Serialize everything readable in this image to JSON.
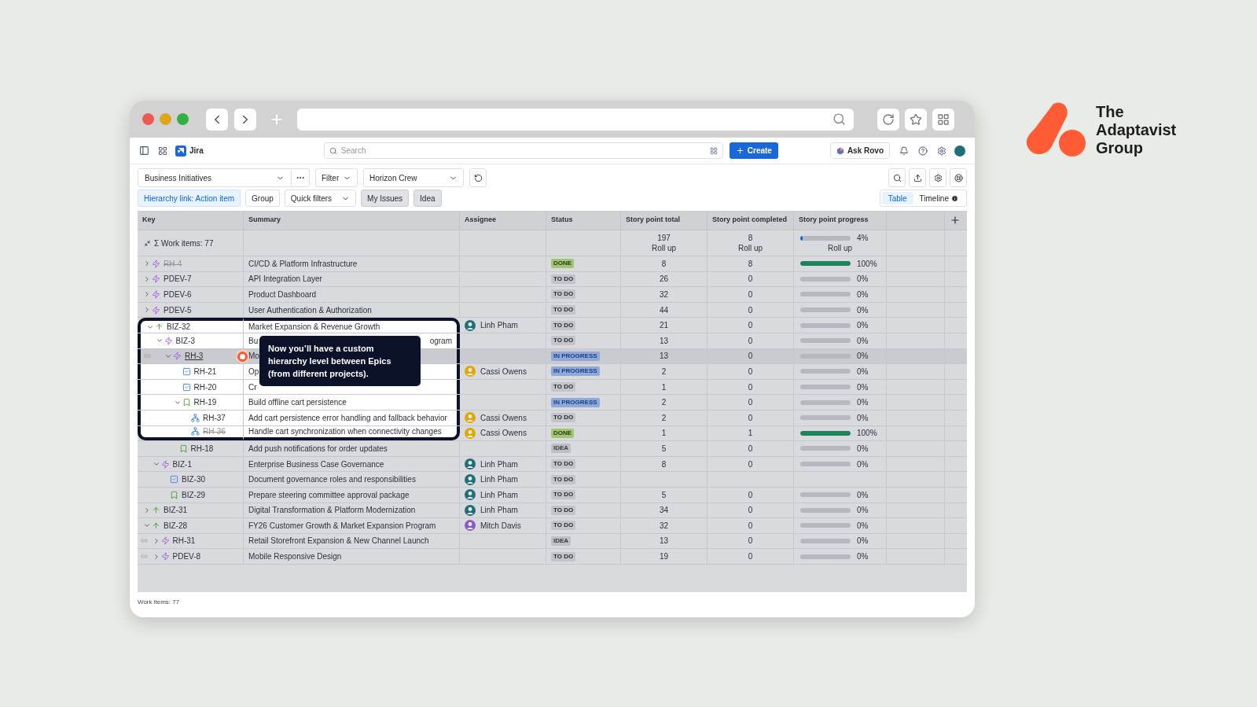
{
  "brand": {
    "name": "The Adaptavist Group"
  },
  "app": {
    "name": "Jira",
    "search_placeholder": "Search",
    "create": "Create",
    "ask": "Ask Rovo"
  },
  "toolbar": {
    "plan": "Business Initiatives",
    "filter": "Filter",
    "team": "Horizon Crew",
    "chips": [
      {
        "label": "Hierarchy link: Action item",
        "kind": "active"
      },
      {
        "label": "Group",
        "kind": "plain"
      },
      {
        "label": "Quick filters",
        "kind": "dropdown"
      },
      {
        "label": "My Issues",
        "kind": "toggle"
      },
      {
        "label": "Idea",
        "kind": "toggle"
      }
    ],
    "views": [
      {
        "label": "Table",
        "selected": true,
        "info": false
      },
      {
        "label": "Timeline",
        "selected": false,
        "info": true
      }
    ]
  },
  "table": {
    "columns": [
      "Key",
      "Summary",
      "Assignee",
      "Status",
      "Story point total",
      "Story point completed",
      "Story point progress"
    ],
    "totals": {
      "label": "Σ Work items: 77",
      "total": "197",
      "total_note": "Roll up",
      "completed": "8",
      "completed_note": "Roll up",
      "progress": {
        "level": 0.04,
        "reading": "4%",
        "note": "Roll up"
      }
    },
    "rows": [
      {
        "key": "RH-4",
        "kind": "epic",
        "summary": "CI/CD & Platform Infrastructure",
        "status": {
          "label": "DONE",
          "kind": "done"
        },
        "total": "8",
        "completed": "8",
        "progress": {
          "level": 1,
          "reading": "100%"
        },
        "expanded": false,
        "done": true,
        "linked": false,
        "selected": false,
        "highlighted": false
      },
      {
        "key": "PDEV-7",
        "kind": "epic",
        "summary": "API Integration Layer",
        "status": {
          "label": "TO DO",
          "kind": "todo"
        },
        "total": "26",
        "completed": "0",
        "progress": {
          "level": 0,
          "reading": "0%"
        },
        "expanded": false,
        "done": false,
        "linked": false,
        "selected": false,
        "highlighted": false
      },
      {
        "key": "PDEV-6",
        "kind": "epic",
        "summary": "Product Dashboard",
        "status": {
          "label": "TO DO",
          "kind": "todo"
        },
        "total": "32",
        "completed": "0",
        "progress": {
          "level": 0,
          "reading": "0%"
        },
        "expanded": false,
        "done": false,
        "linked": false,
        "selected": false,
        "highlighted": false
      },
      {
        "key": "PDEV-5",
        "kind": "epic",
        "summary": "User Authentication & Authorization",
        "status": {
          "label": "TO DO",
          "kind": "todo"
        },
        "total": "44",
        "completed": "0",
        "progress": {
          "level": 0,
          "reading": "0%"
        },
        "expanded": false,
        "done": false,
        "linked": false,
        "selected": false,
        "highlighted": false
      },
      {
        "key": "BIZ-32",
        "kind": "initiative",
        "summary": "Market Expansion & Revenue Growth",
        "assignee": {
          "name": "Linh Pham",
          "color": "#1f6f78"
        },
        "status": {
          "label": "TO DO",
          "kind": "todo"
        },
        "total": "21",
        "completed": "0",
        "progress": {
          "level": 0,
          "reading": "0%"
        },
        "expanded": true,
        "done": false,
        "linked": false,
        "selected": false,
        "highlighted": true,
        "children": [
          {
            "key": "BIZ-3",
            "kind": "epic",
            "summary": "Bu",
            "summary_tail": "ogram",
            "status": {
              "label": "TO DO",
              "kind": "todo"
            },
            "total": "13",
            "completed": "0",
            "progress": {
              "level": 0,
              "reading": "0%"
            },
            "expanded": true,
            "done": false,
            "linked": false,
            "selected": false,
            "highlighted": true,
            "children": [
              {
                "key": "RH-3",
                "kind": "epic",
                "summary": "Mo",
                "status": {
                  "label": "IN PROGRESS",
                  "kind": "progress"
                },
                "total": "13",
                "completed": "0",
                "progress": {
                  "level": 0,
                  "reading": "0%"
                },
                "expanded": true,
                "done": false,
                "linked": true,
                "selected": true,
                "highlighted": true,
                "children": [
                  {
                    "key": "RH-21",
                    "kind": "task",
                    "summary": "Op",
                    "assignee": {
                      "name": "Cassi Owens",
                      "color": "#e0a800"
                    },
                    "status": {
                      "label": "IN PROGRESS",
                      "kind": "progress"
                    },
                    "total": "2",
                    "completed": "0",
                    "progress": {
                      "level": 0,
                      "reading": "0%"
                    },
                    "done": false,
                    "linked": false,
                    "selected": false,
                    "highlighted": true
                  },
                  {
                    "key": "RH-20",
                    "kind": "task",
                    "summary": "Cr",
                    "status": {
                      "label": "TO DO",
                      "kind": "todo"
                    },
                    "total": "1",
                    "completed": "0",
                    "progress": {
                      "level": 0,
                      "reading": "0%"
                    },
                    "done": false,
                    "linked": false,
                    "selected": false,
                    "highlighted": true
                  },
                  {
                    "key": "RH-19",
                    "kind": "story",
                    "summary": "Build offline cart persistence",
                    "status": {
                      "label": "IN PROGRESS",
                      "kind": "progress"
                    },
                    "total": "2",
                    "completed": "0",
                    "progress": {
                      "level": 0,
                      "reading": "0%"
                    },
                    "expanded": true,
                    "done": false,
                    "linked": false,
                    "selected": false,
                    "highlighted": true,
                    "children": [
                      {
                        "key": "RH-37",
                        "kind": "subtask",
                        "summary": "Add cart persistence error handling and fallback behavior",
                        "assignee": {
                          "name": "Cassi Owens",
                          "color": "#e0a800"
                        },
                        "status": {
                          "label": "TO DO",
                          "kind": "todo"
                        },
                        "total": "2",
                        "completed": "0",
                        "progress": {
                          "level": 0,
                          "reading": "0%"
                        },
                        "done": false,
                        "linked": false,
                        "selected": false,
                        "highlighted": true
                      },
                      {
                        "key": "RH-36",
                        "kind": "subtask",
                        "summary": "Handle cart synchronization when connectivity changes",
                        "assignee": {
                          "name": "Cassi Owens",
                          "color": "#e0a800"
                        },
                        "status": {
                          "label": "DONE",
                          "kind": "done"
                        },
                        "total": "1",
                        "completed": "1",
                        "progress": {
                          "level": 1,
                          "reading": "100%"
                        },
                        "done": true,
                        "linked": false,
                        "selected": false,
                        "highlighted": true
                      }
                    ]
                  },
                  {
                    "key": "RH-18",
                    "kind": "story",
                    "summary": "Add push notifications for order updates",
                    "status": {
                      "label": "IDEA",
                      "kind": "idea"
                    },
                    "total": "5",
                    "completed": "0",
                    "progress": {
                      "level": 0,
                      "reading": "0%"
                    },
                    "done": false,
                    "linked": false,
                    "selected": false,
                    "highlighted": false
                  }
                ]
              }
            ]
          },
          {
            "key": "BIZ-1",
            "kind": "epic",
            "summary": "Enterprise Business Case Governance",
            "assignee": {
              "name": "Linh Pham",
              "color": "#1f6f78"
            },
            "status": {
              "label": "TO DO",
              "kind": "todo"
            },
            "total": "8",
            "completed": "0",
            "progress": {
              "level": 0,
              "reading": "0%"
            },
            "expanded": true,
            "done": false,
            "linked": false,
            "selected": false,
            "highlighted": false,
            "children": [
              {
                "key": "BIZ-30",
                "kind": "task",
                "summary": "Document governance roles and responsibilities",
                "assignee": {
                  "name": "Linh Pham",
                  "color": "#1f6f78"
                },
                "status": {
                  "label": "TO DO",
                  "kind": "todo"
                },
                "done": false,
                "linked": false,
                "selected": false,
                "highlighted": false
              },
              {
                "key": "BIZ-29",
                "kind": "story",
                "summary": "Prepare steering committee approval package",
                "assignee": {
                  "name": "Linh Pham",
                  "color": "#1f6f78"
                },
                "status": {
                  "label": "TO DO",
                  "kind": "todo"
                },
                "total": "5",
                "completed": "0",
                "progress": {
                  "level": 0,
                  "reading": "0%"
                },
                "done": false,
                "linked": false,
                "selected": false,
                "highlighted": false
              }
            ]
          }
        ]
      },
      {
        "key": "BIZ-31",
        "kind": "initiative",
        "summary": "Digital Transformation & Platform Modernization",
        "assignee": {
          "name": "Linh Pham",
          "color": "#1f6f78"
        },
        "status": {
          "label": "TO DO",
          "kind": "todo"
        },
        "total": "34",
        "completed": "0",
        "progress": {
          "level": 0,
          "reading": "0%"
        },
        "expanded": false,
        "done": false,
        "linked": false,
        "selected": false,
        "highlighted": false
      },
      {
        "key": "BIZ-28",
        "kind": "initiative",
        "summary": "FY26 Customer Growth & Market Expansion Program",
        "assignee": {
          "name": "Mitch Davis",
          "color": "#8a5cc7"
        },
        "status": {
          "label": "TO DO",
          "kind": "todo"
        },
        "total": "32",
        "completed": "0",
        "progress": {
          "level": 0,
          "reading": "0%"
        },
        "expanded": true,
        "done": false,
        "linked": false,
        "selected": false,
        "highlighted": false,
        "children": [
          {
            "key": "RH-31",
            "kind": "epic",
            "summary": "Retail Storefront Expansion & New Channel Launch",
            "status": {
              "label": "IDEA",
              "kind": "idea"
            },
            "total": "13",
            "completed": "0",
            "progress": {
              "level": 0,
              "reading": "0%"
            },
            "expanded": false,
            "done": false,
            "linked": true,
            "selected": false,
            "highlighted": false
          },
          {
            "key": "PDEV-8",
            "kind": "epic",
            "summary": "Mobile Responsive Design",
            "status": {
              "label": "TO DO",
              "kind": "todo"
            },
            "total": "19",
            "completed": "0",
            "progress": {
              "level": 0,
              "reading": "0%"
            },
            "expanded": false,
            "done": false,
            "linked": true,
            "selected": false,
            "highlighted": false
          }
        ]
      }
    ]
  },
  "tour_tip": {
    "text": "Now you’ll have a custom hierarchy level between Epics (from different projects)."
  },
  "footer": {
    "text": "Work items: 77"
  }
}
